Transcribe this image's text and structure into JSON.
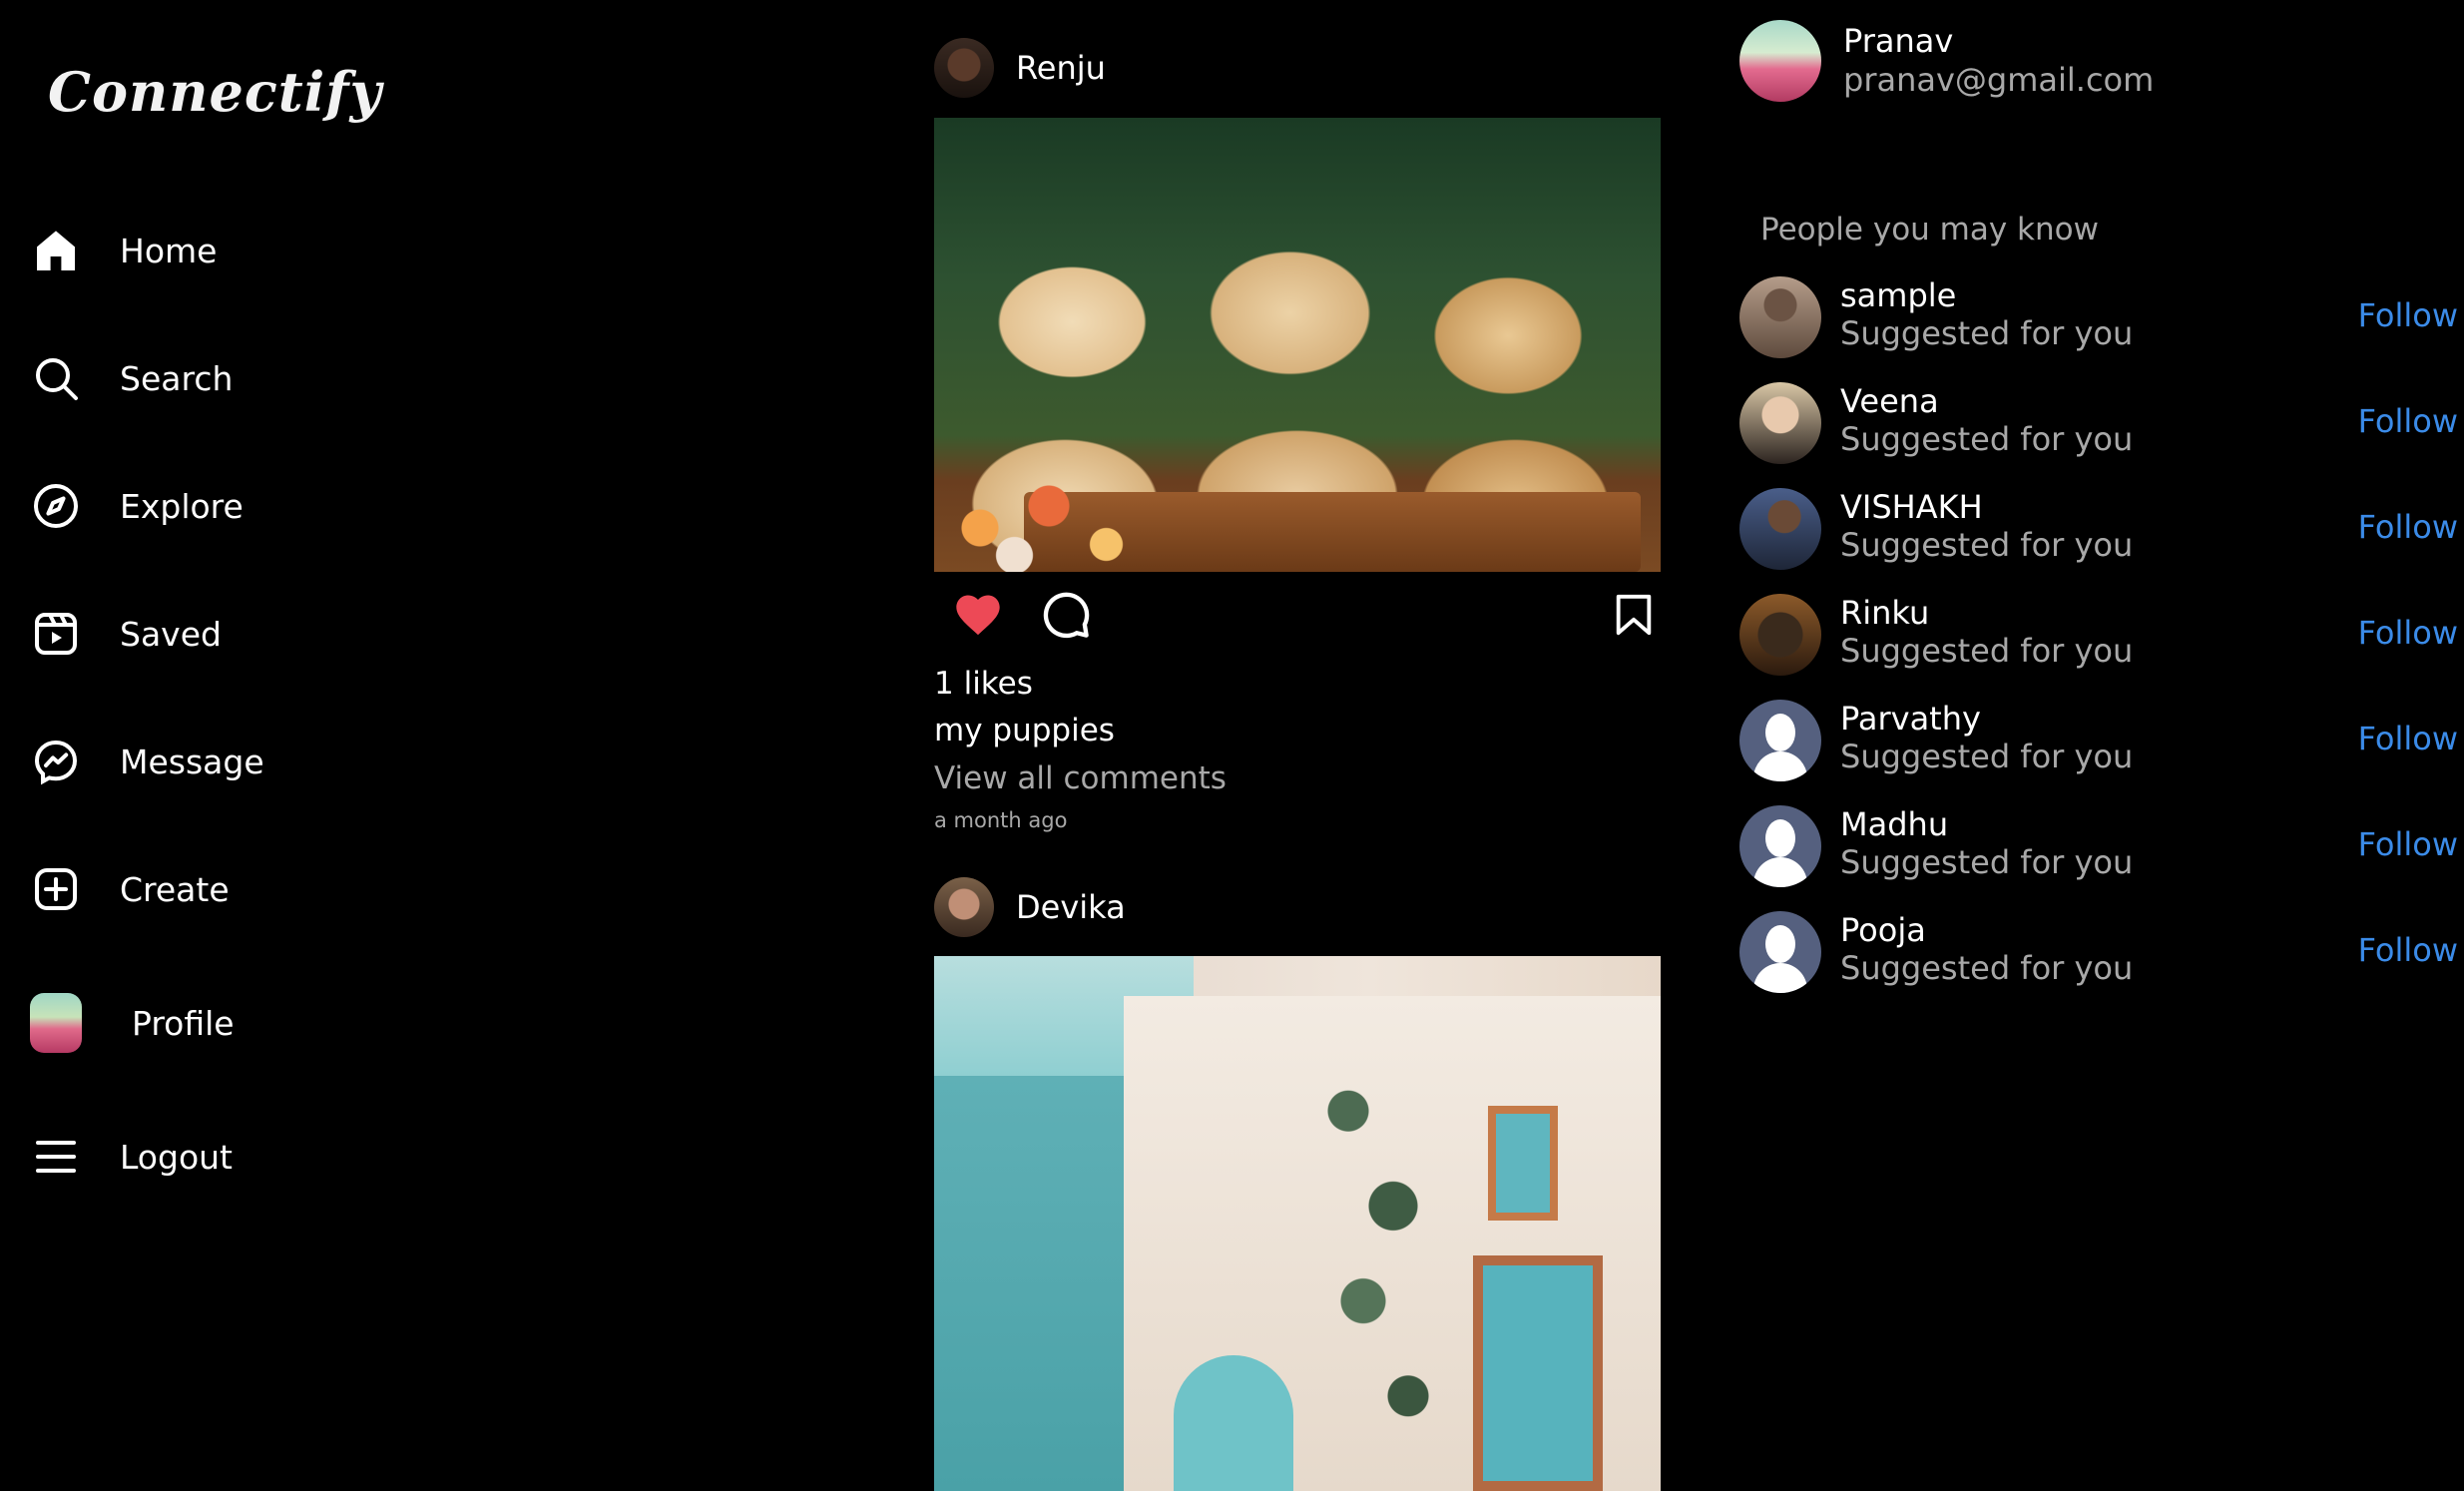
{
  "app": {
    "name": "Connectify"
  },
  "sidebar": {
    "items": [
      {
        "label": "Home",
        "icon": "home-icon"
      },
      {
        "label": "Search",
        "icon": "search-icon"
      },
      {
        "label": "Explore",
        "icon": "compass-icon"
      },
      {
        "label": "Saved",
        "icon": "reels-icon"
      },
      {
        "label": "Message",
        "icon": "messenger-icon"
      },
      {
        "label": "Create",
        "icon": "plus-square-icon"
      },
      {
        "label": "Profile",
        "icon": "profile-avatar"
      },
      {
        "label": "Logout",
        "icon": "menu-icon"
      }
    ]
  },
  "feed": {
    "posts": [
      {
        "user": "Renju",
        "likes": "1 likes",
        "caption": "my puppies",
        "view_comments": "View all comments",
        "time": "a month ago",
        "liked": true
      },
      {
        "user": "Devika"
      }
    ]
  },
  "current_user": {
    "name": "Pranav",
    "email": "pranav@gmail.com"
  },
  "suggestions": {
    "title": "People you may know",
    "follow_label": "Follow",
    "subtitle": "Suggested for you",
    "people": [
      {
        "name": "sample"
      },
      {
        "name": "Veena"
      },
      {
        "name": "VISHAKH"
      },
      {
        "name": "Rinku"
      },
      {
        "name": "Parvathy"
      },
      {
        "name": "Madhu"
      },
      {
        "name": "Pooja"
      }
    ]
  },
  "colors": {
    "background": "#000000",
    "like_red": "#ed4956",
    "follow_blue": "#3b8be8",
    "muted_text": "#a8a8a8"
  }
}
